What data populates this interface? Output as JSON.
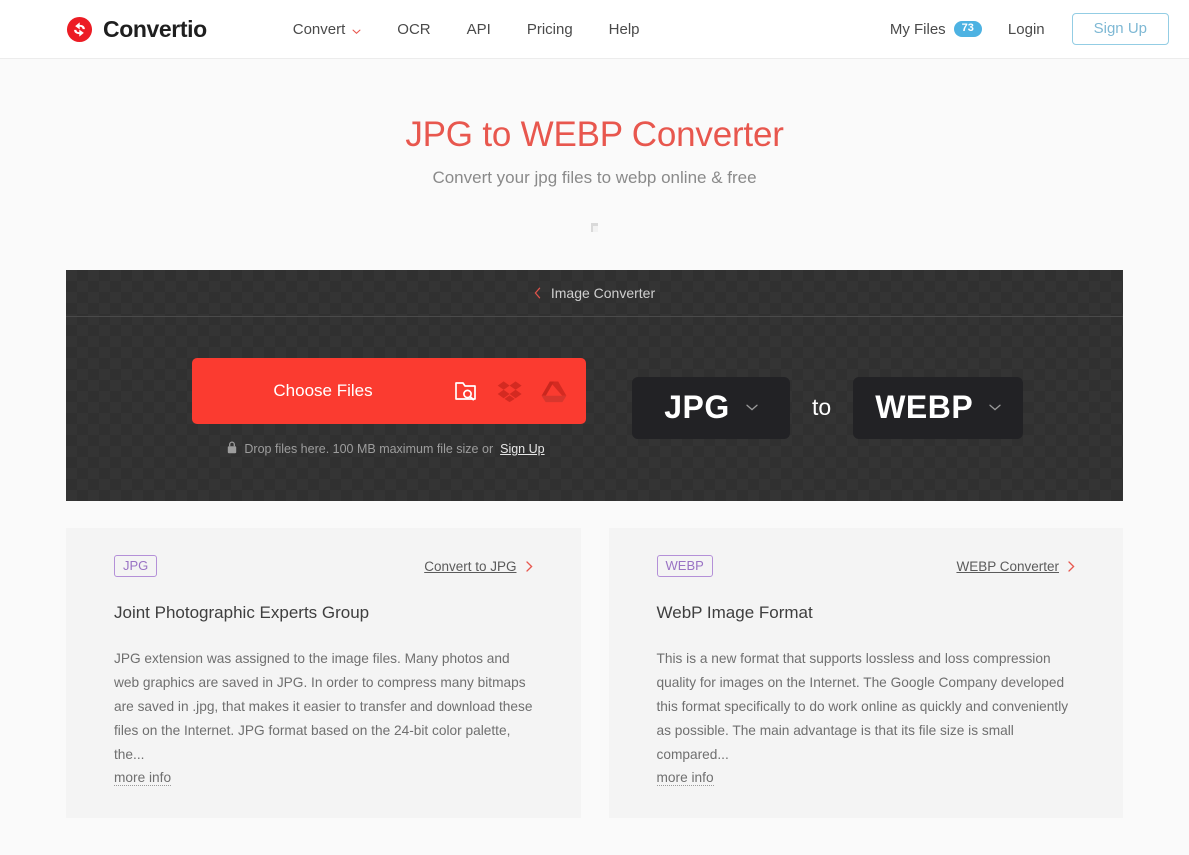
{
  "header": {
    "brand": "Convertio",
    "brand_icon": "convertio-refresh-logo",
    "nav": [
      {
        "label": "Convert",
        "icon": "chevron-down-icon",
        "has_chevron": true
      },
      {
        "label": "OCR",
        "has_chevron": false
      },
      {
        "label": "API",
        "has_chevron": false
      },
      {
        "label": "Pricing",
        "has_chevron": false
      },
      {
        "label": "Help",
        "has_chevron": false
      }
    ],
    "my_files_label": "My Files",
    "my_files_count": "73",
    "login_label": "Login",
    "signup_label": "Sign Up"
  },
  "hero": {
    "title": "JPG to WEBP Converter",
    "subtitle": "Convert your jpg files to webp online & free"
  },
  "converter": {
    "breadcrumb_label": "Image Converter",
    "breadcrumb_icon": "chevron-left-icon",
    "choose_files_label": "Choose Files",
    "sources": [
      {
        "name": "folder-search-icon"
      },
      {
        "name": "dropbox-icon"
      },
      {
        "name": "google-drive-icon"
      }
    ],
    "drop_lock_icon": "lock-icon",
    "drop_text": "Drop files here. 100 MB maximum file size or",
    "drop_signup_label": "Sign Up",
    "source_format": "JPG",
    "to_label": "to",
    "target_format": "WEBP",
    "select_icon": "chevron-down-icon"
  },
  "cards": [
    {
      "badge": "JPG",
      "link_label": "Convert to JPG",
      "link_icon": "chevron-right-icon",
      "title": "Joint Photographic Experts Group",
      "description": "JPG extension was assigned to the image files. Many photos and web graphics are saved in JPG. In order to compress many bitmaps are saved in .jpg, that makes it easier to transfer and download these files on the Internet. JPG format based on the 24-bit color palette, the...",
      "more_info_label": "more info"
    },
    {
      "badge": "WEBP",
      "link_label": "WEBP Converter",
      "link_icon": "chevron-right-icon",
      "title": "WebP Image Format",
      "description": "This is a new format that supports lossless and loss compression quality for images on the Internet. The Google Company developed this format specifically to do work online as quickly and conveniently as possible. The main advantage is that its file size is small compared...",
      "more_info_label": "more info"
    }
  ],
  "colors": {
    "brand_red": "#e8574e",
    "action_red": "#fb3b30",
    "badge_blue": "#4db2e2",
    "signup_blue": "#93cde4",
    "format_badge_purple": "#b490d8",
    "panel_dark": "#343434"
  }
}
